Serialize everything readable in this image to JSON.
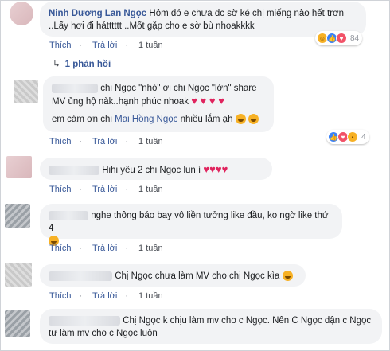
{
  "c1": {
    "author": "Ninh Dương Lan Ngọc",
    "text": "Hôm đó e chưa đc sờ ké chị miếng nào hết trơn ..Lấy hơi đi hátttttt ..Mốt gặp cho e sờ bù nhoakkkk",
    "like_action": "Thích",
    "reply_action": "Trả lời",
    "time": "1 tuần",
    "reaction_count": "84",
    "replies_link": "1 phản hồi"
  },
  "c2": {
    "text_a": "chị Ngọc \"nhỏ\" ơi chị Ngọc \"lớn\" share MV ủng hộ nàk..hạnh phúc nhoak",
    "text_b_prefix": "em cám ơn chị",
    "text_b_tag": "Mai Hồng Ngọc",
    "text_b_suffix": "nhiều lắm ạh",
    "like_action": "Thích",
    "reply_action": "Trả lời",
    "time": "1 tuần",
    "reaction_count": "4"
  },
  "c3": {
    "text": "Hihi yêu 2 chị Ngọc lun í",
    "like_action": "Thích",
    "reply_action": "Trả lời",
    "time": "1 tuần"
  },
  "c4": {
    "text": "nghe thông báo bay vô liền tưởng like đầu, ko ngờ like thứ 4",
    "like_action": "Thích",
    "reply_action": "Trả lời",
    "time": "1 tuần"
  },
  "c5": {
    "text": "Chị Ngọc chưa làm MV cho chị Ngọc kìa",
    "like_action": "Thích",
    "reply_action": "Trả lời",
    "time": "1 tuần"
  },
  "c6": {
    "text": "Chị Ngọc k chịu làm mv cho c Ngọc. Nên C Ngọc dận c Ngọc tự làm mv cho c Ngọc luôn"
  },
  "colors": {
    "link": "#385898",
    "bubble": "#f2f3f5",
    "heart": "#e0245e"
  }
}
